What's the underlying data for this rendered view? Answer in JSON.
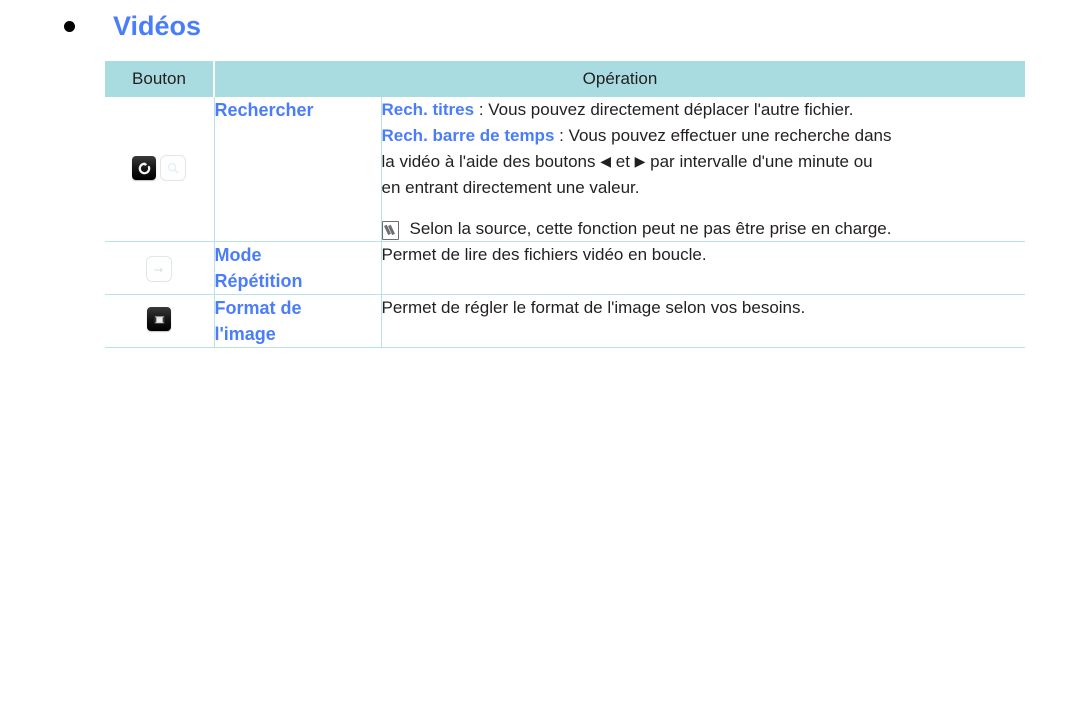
{
  "heading": {
    "bullet_icon": "bullet-dot",
    "title": "Vidéos"
  },
  "table": {
    "headers": {
      "button": "Bouton",
      "operation": "Opération"
    },
    "rows": [
      {
        "icons": [
          "rotate-search-key-icon",
          "magnifier-key-icon"
        ],
        "name": "Rechercher",
        "lines": [
          {
            "strong": "Rech. titres",
            "text": " : Vous pouvez directement déplacer l'autre fichier."
          },
          {
            "strong": "Rech. barre de temps",
            "text": " : Vous pouvez effectuer une recherche dans",
            "line2_a": "la vidéo à l'aide des boutons ",
            "left_arrow": "◀",
            "line2_b": " et ",
            "right_arrow": "▶",
            "line2_c": " par intervalle d'une minute ou",
            "line3": "en entrant directement une valeur."
          }
        ],
        "note": "Selon la source, cette fonction peut ne pas être prise en charge.",
        "note_icon": "note-pencil-icon"
      },
      {
        "icons": [
          "arrow-right-key-icon"
        ],
        "name_line1": "Mode",
        "name_line2": "Répétition",
        "description": "Permet de lire des fichiers vidéo en boucle."
      },
      {
        "icons": [
          "picture-format-key-icon"
        ],
        "name_line1": "Format de",
        "name_line2": "l'image",
        "description": "Permet de régler le format de l'image selon vos besoins."
      }
    ]
  },
  "colors": {
    "header_bg": "#a9dce0",
    "accent_blue": "#4a7dfb",
    "row_divider": "#b8e2e6",
    "text": "#231f20",
    "page_bg": "#ffffff"
  }
}
